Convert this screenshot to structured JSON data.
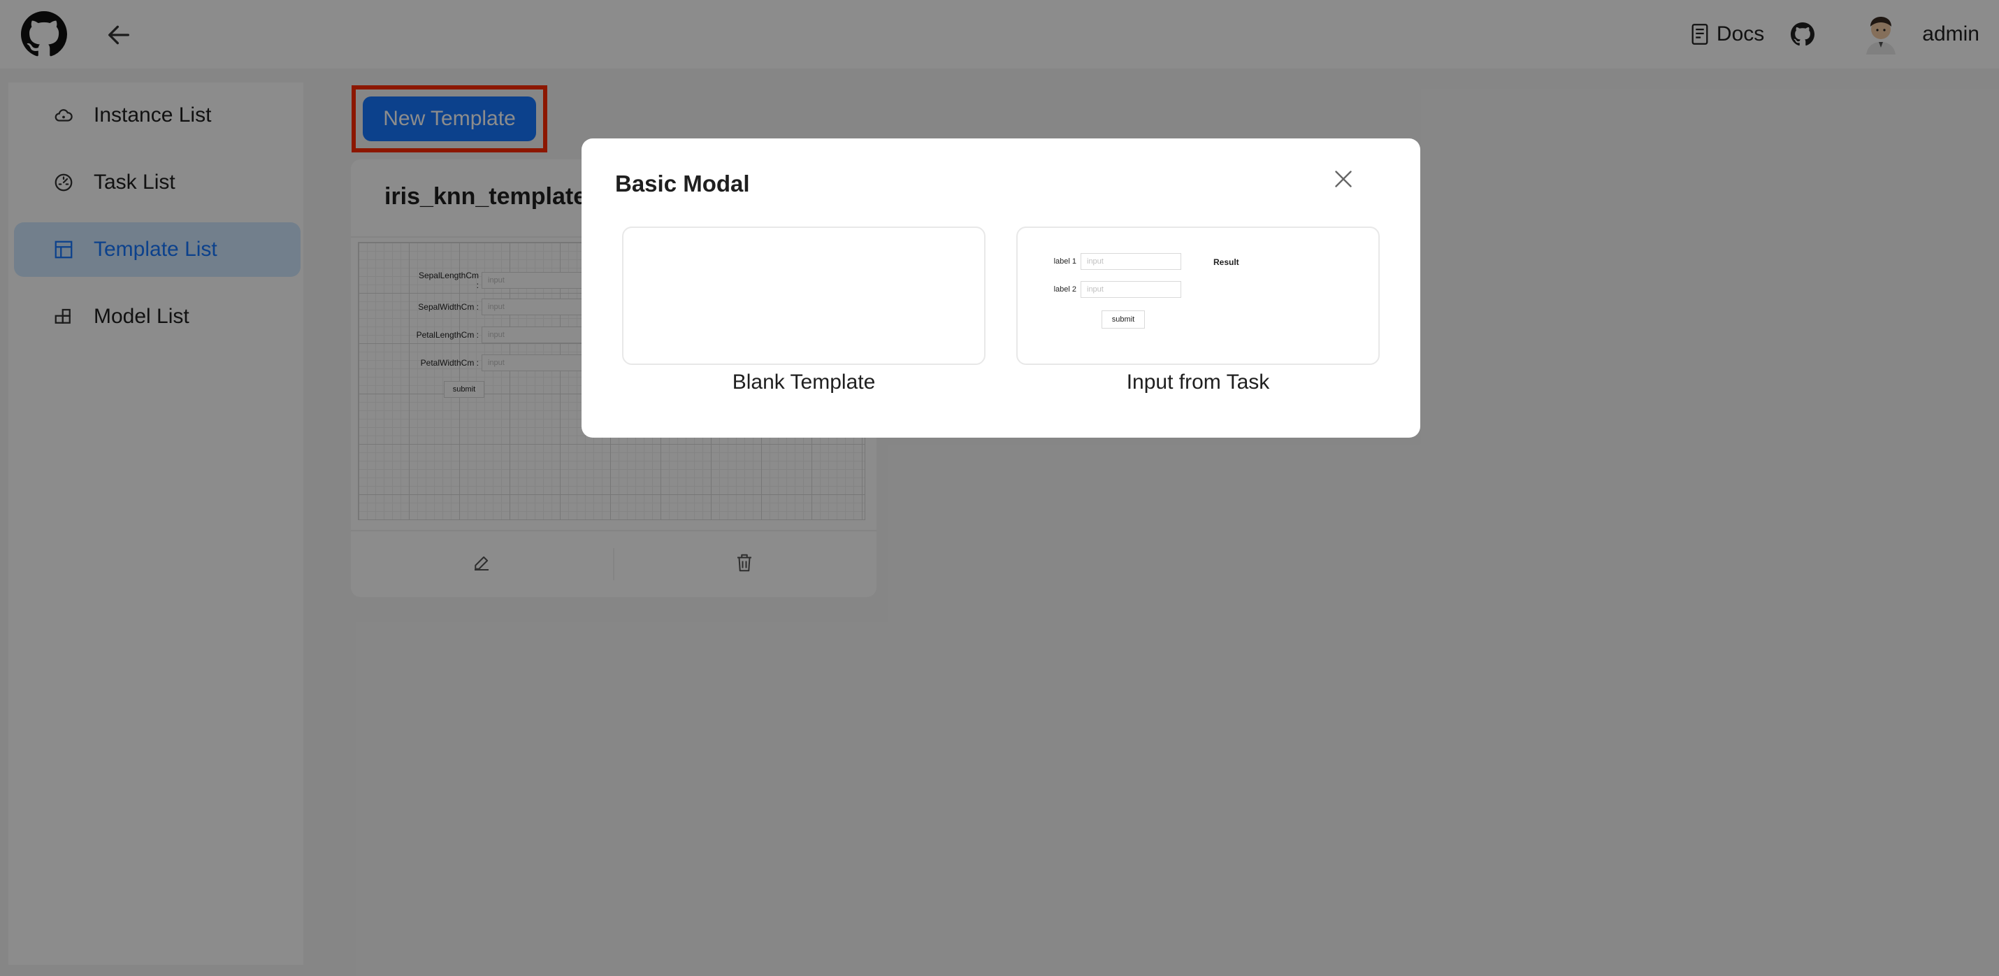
{
  "header": {
    "docs_label": "Docs",
    "user_name": "admin"
  },
  "sidebar": {
    "items": [
      {
        "label": "Instance List",
        "icon": "cloud-icon",
        "active": false
      },
      {
        "label": "Task List",
        "icon": "dashboard-icon",
        "active": false
      },
      {
        "label": "Template List",
        "icon": "layout-icon",
        "active": true
      },
      {
        "label": "Model List",
        "icon": "blocks-icon",
        "active": false
      }
    ]
  },
  "main": {
    "new_template_label": "New Template",
    "cards": [
      {
        "title": "iris_knn_template",
        "fields": [
          "SepalLengthCm :",
          "SepalWidthCm :",
          "PetalLengthCm :",
          "PetalWidthCm :"
        ],
        "input_placeholder": "input",
        "submit_label": "submit"
      }
    ]
  },
  "modal": {
    "title": "Basic Modal",
    "options": [
      {
        "label": "Blank Template"
      },
      {
        "label": "Input from Task",
        "preview": {
          "labels": [
            "label 1",
            "label 2"
          ],
          "input_placeholder": "input",
          "result_label": "Result",
          "submit_label": "submit"
        }
      }
    ]
  },
  "colors": {
    "accent": "#1677ff",
    "highlight_border": "#ff2a00",
    "active_bg": "#cfe8ff"
  }
}
